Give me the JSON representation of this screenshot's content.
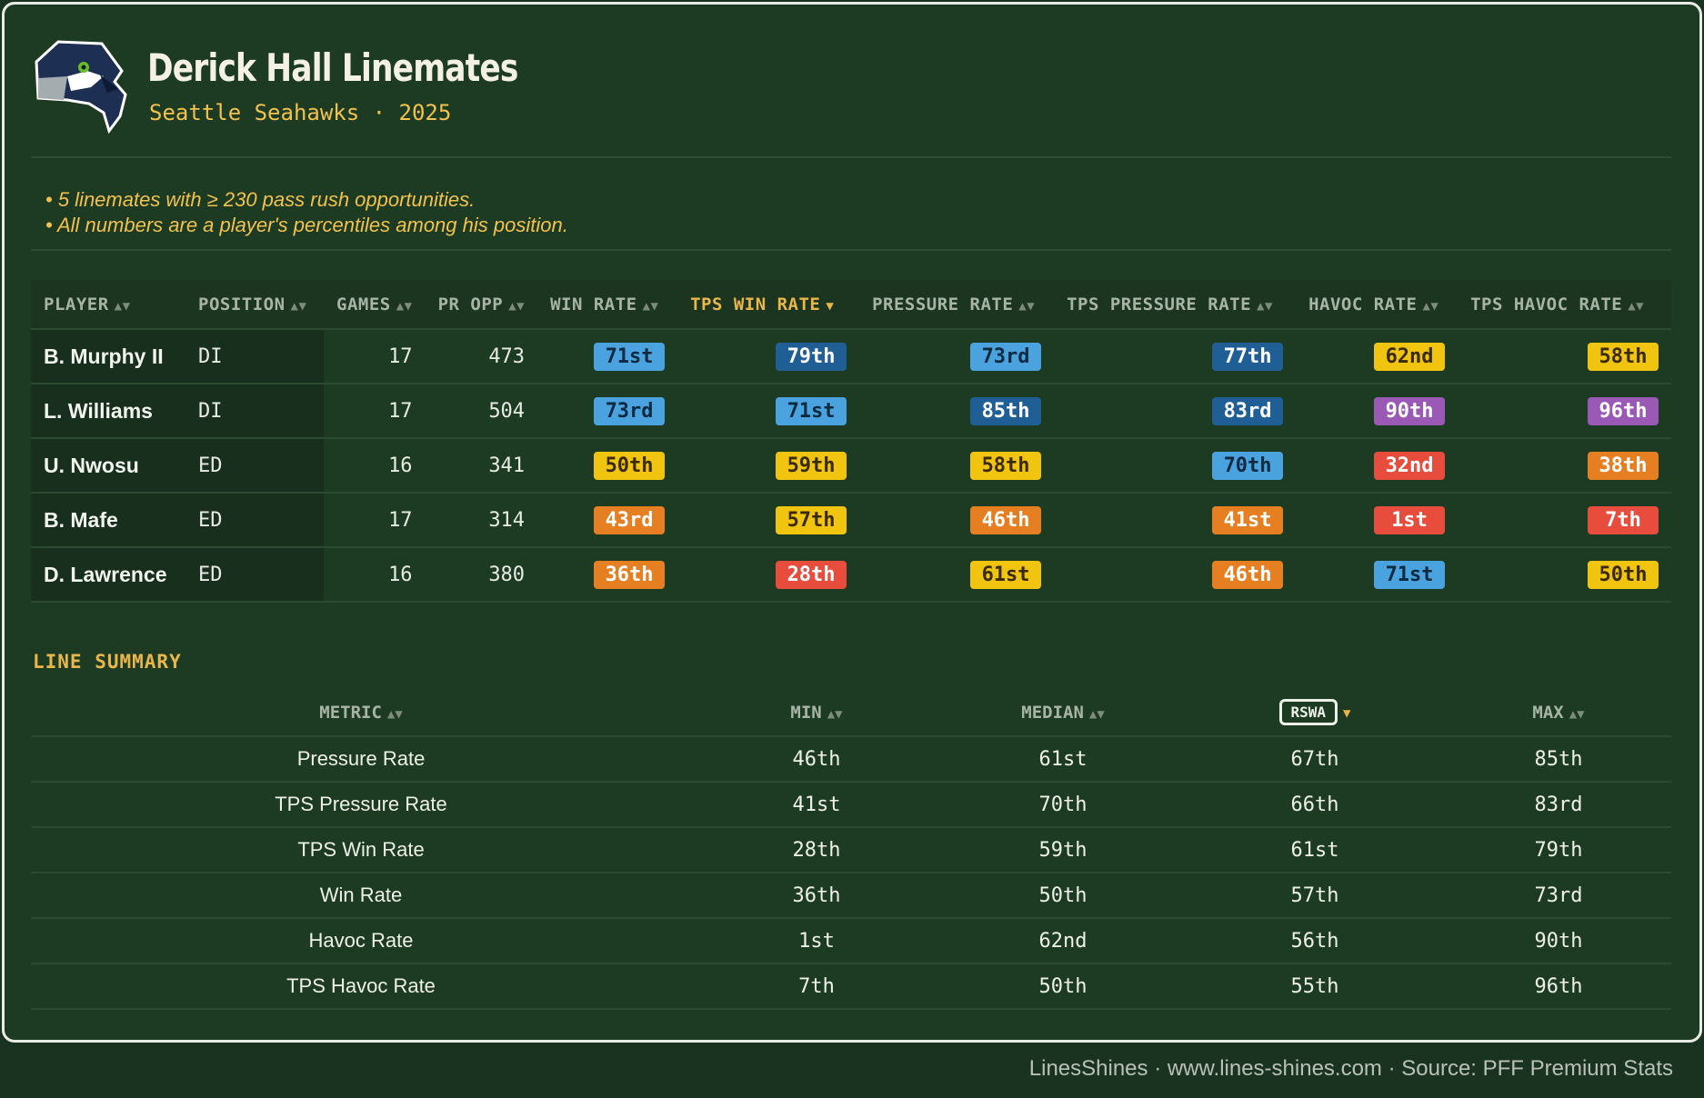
{
  "header": {
    "title": "Derick Hall Linemates",
    "subtitle": "Seattle Seahawks · 2025"
  },
  "notes": [
    "• 5 linemates with ≥ 230 pass rush opportunities.",
    "• All numbers are a player's percentiles among his position."
  ],
  "main_table": {
    "columns": [
      "PLAYER",
      "POSITION",
      "GAMES",
      "PR OPP",
      "WIN RATE",
      "TPS WIN RATE",
      "PRESSURE RATE",
      "TPS PRESSURE RATE",
      "HAVOC RATE",
      "TPS HAVOC RATE"
    ],
    "sorted_column": "TPS WIN RATE",
    "rows": [
      {
        "player": "B. Murphy II",
        "position": "DI",
        "games": "17",
        "pr_opp": "473",
        "win_rate": "71st",
        "tps_win_rate": "79th",
        "pressure_rate": "73rd",
        "tps_pressure_rate": "77th",
        "havoc_rate": "62nd",
        "tps_havoc_rate": "58th"
      },
      {
        "player": "L. Williams",
        "position": "DI",
        "games": "17",
        "pr_opp": "504",
        "win_rate": "73rd",
        "tps_win_rate": "71st",
        "pressure_rate": "85th",
        "tps_pressure_rate": "83rd",
        "havoc_rate": "90th",
        "tps_havoc_rate": "96th"
      },
      {
        "player": "U. Nwosu",
        "position": "ED",
        "games": "16",
        "pr_opp": "341",
        "win_rate": "50th",
        "tps_win_rate": "59th",
        "pressure_rate": "58th",
        "tps_pressure_rate": "70th",
        "havoc_rate": "32nd",
        "tps_havoc_rate": "38th"
      },
      {
        "player": "B. Mafe",
        "position": "ED",
        "games": "17",
        "pr_opp": "314",
        "win_rate": "43rd",
        "tps_win_rate": "57th",
        "pressure_rate": "46th",
        "tps_pressure_rate": "41st",
        "havoc_rate": "1st",
        "tps_havoc_rate": "7th"
      },
      {
        "player": "D. Lawrence",
        "position": "ED",
        "games": "16",
        "pr_opp": "380",
        "win_rate": "36th",
        "tps_win_rate": "28th",
        "pressure_rate": "61st",
        "tps_pressure_rate": "46th",
        "havoc_rate": "71st",
        "tps_havoc_rate": "50th"
      }
    ]
  },
  "summary": {
    "title": "LINE SUMMARY",
    "columns": [
      "METRIC",
      "MIN",
      "MEDIAN",
      "RSWA",
      "MAX"
    ],
    "sorted_column": "RSWA",
    "rows": [
      {
        "metric": "Pressure Rate",
        "min": "46th",
        "median": "61st",
        "rswa": "67th",
        "max": "85th"
      },
      {
        "metric": "TPS Pressure Rate",
        "min": "41st",
        "median": "70th",
        "rswa": "66th",
        "max": "83rd"
      },
      {
        "metric": "TPS Win Rate",
        "min": "28th",
        "median": "59th",
        "rswa": "61st",
        "max": "79th"
      },
      {
        "metric": "Win Rate",
        "min": "36th",
        "median": "50th",
        "rswa": "57th",
        "max": "73rd"
      },
      {
        "metric": "Havoc Rate",
        "min": "1st",
        "median": "62nd",
        "rswa": "56th",
        "max": "90th"
      },
      {
        "metric": "TPS Havoc Rate",
        "min": "7th",
        "median": "50th",
        "rswa": "55th",
        "max": "96th"
      }
    ]
  },
  "footer": "LinesShines · www.lines-shines.com · Source: PFF Premium Stats",
  "colors": {
    "background": "#1d3b22",
    "accent": "#e9b64a",
    "tier_blue_dark": "#1f5f96",
    "tier_blue_light": "#4aa3df",
    "tier_purple": "#9b59b6",
    "tier_yellow": "#f1c40f",
    "tier_orange": "#e67e22",
    "tier_red": "#e74c3c"
  },
  "icons": {
    "logo": "seahawks-logo-icon",
    "sort": "sort-arrows-icon",
    "sort_desc": "sort-desc-icon"
  }
}
